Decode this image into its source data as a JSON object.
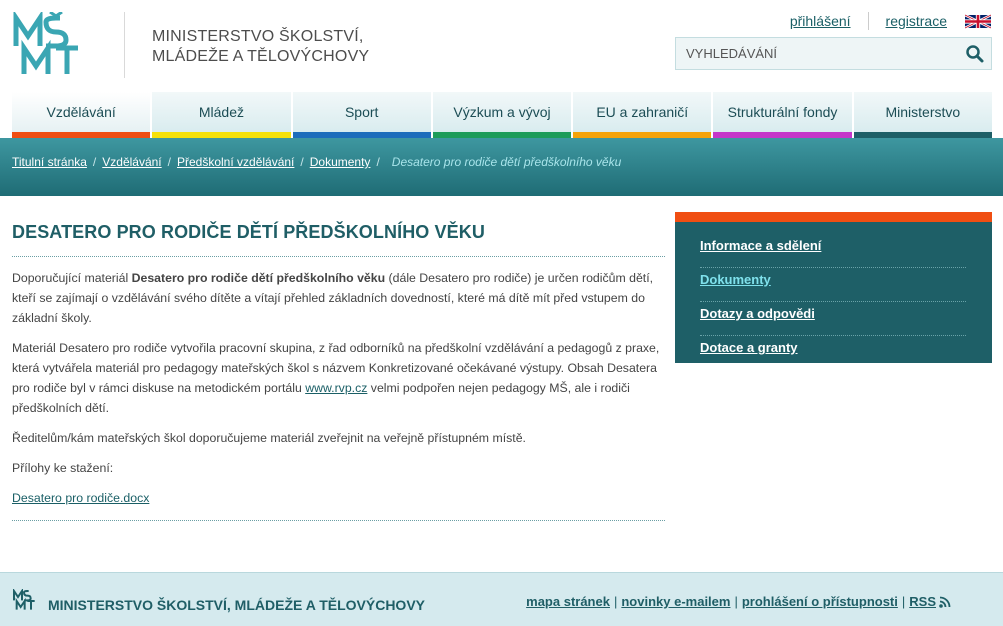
{
  "header": {
    "logo_alt": "MŠMT",
    "org_line1": "MINISTERSTVO ŠKOLSTVÍ,",
    "org_line2": "MLÁDEŽE A TĚLOVÝCHOVY",
    "login_link": "přihlášení",
    "register_link": "registrace",
    "language_icon": "uk-flag-icon",
    "search_placeholder": "VYHLEDÁVÁNÍ"
  },
  "nav": {
    "items": [
      {
        "label": "Vzdělávání",
        "color": "#f04e12",
        "active": true
      },
      {
        "label": "Mládež",
        "color": "#f5e10a",
        "active": false
      },
      {
        "label": "Sport",
        "color": "#1d6dbb",
        "active": false
      },
      {
        "label": "Výzkum a vývoj",
        "color": "#1d9c5a",
        "active": false
      },
      {
        "label": "EU a zahraničí",
        "color": "#f5a30a",
        "active": false
      },
      {
        "label": "Strukturální fondy",
        "color": "#c536c9",
        "active": false
      },
      {
        "label": "Ministerstvo",
        "color": "#1e5f67",
        "active": false
      }
    ]
  },
  "breadcrumb": {
    "items": [
      "Titulní stránka",
      "Vzdělávání",
      "Předškolní vzdělávání",
      "Dokumenty"
    ],
    "current": "Desatero pro rodiče dětí předškolního věku"
  },
  "main": {
    "title": "DESATERO PRO RODIČE DĚTÍ PŘEDŠKOLNÍHO VĚKU",
    "p1_pre": "Doporučující materiál ",
    "p1_bold": "Desatero pro rodiče dětí předškolního věku",
    "p1_post": " (dále Desatero pro rodiče) je určen rodičům dětí, kteří se zajímají o vzdělávání svého dítěte a vítají přehled základních dovedností, které má dítě mít před vstupem do základní školy.",
    "p2_pre": "Materiál Desatero pro rodiče vytvořila pracovní skupina, z řad odborníků na předškolní vzdělávání a pedagogů z praxe, která vytvářela materiál pro pedagogy mateřských škol s názvem Konkretizované očekávané výstupy. Obsah Desatera pro rodiče byl v rámci diskuse na metodickém portálu ",
    "p2_link": "www.rvp.cz",
    "p2_post": " velmi podpořen nejen pedagogy MŠ, ale i rodiči předškolních dětí.",
    "p3": "Ředitelům/kám mateřských škol doporučujeme materiál zveřejnit na veřejně přístupném místě.",
    "attachments_label": "Přílohy ke stažení:",
    "attachment_link": "Desatero pro rodiče.docx"
  },
  "side_menu": {
    "items": [
      {
        "label": "Informace a sdělení",
        "active": false
      },
      {
        "label": "Dokumenty",
        "active": true
      },
      {
        "label": "Dotazy a odpovědi",
        "active": false
      },
      {
        "label": "Dotace a granty",
        "active": false
      }
    ]
  },
  "footer": {
    "org_name": "MINISTERSTVO ŠKOLSTVÍ, MLÁDEŽE A TĚLOVÝCHOVY",
    "links": [
      "mapa stránek",
      "novinky e-mailem",
      "prohlášení o přístupnosti",
      "RSS"
    ],
    "rss_icon": "rss-icon"
  },
  "colors": {
    "brand_teal": "#1e5f67",
    "accent_orange": "#f04e12",
    "active_side": "#7fe1ec"
  }
}
